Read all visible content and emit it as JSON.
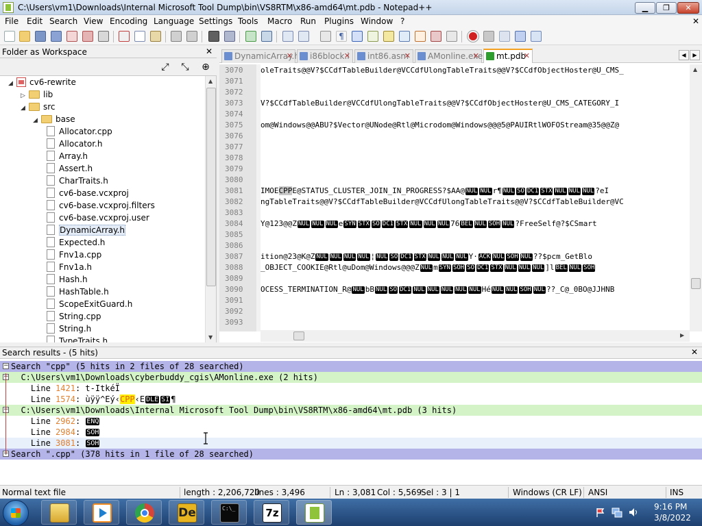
{
  "window": {
    "title": "C:\\Users\\vm1\\Downloads\\Internal Microsoft Tool Dump\\bin\\VS8RTM\\x86-amd64\\mt.pdb - Notepad++",
    "minimize": "▁",
    "maximize": "❐",
    "close": "✕"
  },
  "menu": {
    "items": [
      "File",
      "Edit",
      "Search",
      "View",
      "Encoding",
      "Language",
      "Settings",
      "Tools",
      "Macro",
      "Run",
      "Plugins",
      "Window",
      "?"
    ],
    "close": "✕"
  },
  "left_panel": {
    "title": "Folder as Workspace",
    "close": "✕",
    "tree": [
      {
        "label": "cv6-rewrite",
        "depth": 0,
        "kind": "project",
        "twisty": "◢"
      },
      {
        "label": "lib",
        "depth": 1,
        "kind": "folder",
        "twisty": "▷"
      },
      {
        "label": "src",
        "depth": 1,
        "kind": "folder",
        "twisty": "◢"
      },
      {
        "label": "base",
        "depth": 2,
        "kind": "folder",
        "twisty": "◢"
      },
      {
        "label": "Allocator.cpp",
        "depth": 3,
        "kind": "file"
      },
      {
        "label": "Allocator.h",
        "depth": 3,
        "kind": "file"
      },
      {
        "label": "Array.h",
        "depth": 3,
        "kind": "file"
      },
      {
        "label": "Assert.h",
        "depth": 3,
        "kind": "file"
      },
      {
        "label": "CharTraits.h",
        "depth": 3,
        "kind": "file"
      },
      {
        "label": "cv6-base.vcxproj",
        "depth": 3,
        "kind": "file"
      },
      {
        "label": "cv6-base.vcxproj.filters",
        "depth": 3,
        "kind": "file"
      },
      {
        "label": "cv6-base.vcxproj.user",
        "depth": 3,
        "kind": "file"
      },
      {
        "label": "DynamicArray.h",
        "depth": 3,
        "kind": "file",
        "selected": true
      },
      {
        "label": "Expected.h",
        "depth": 3,
        "kind": "file"
      },
      {
        "label": "Fnv1a.cpp",
        "depth": 3,
        "kind": "file"
      },
      {
        "label": "Fnv1a.h",
        "depth": 3,
        "kind": "file"
      },
      {
        "label": "Hash.h",
        "depth": 3,
        "kind": "file"
      },
      {
        "label": "HashTable.h",
        "depth": 3,
        "kind": "file"
      },
      {
        "label": "ScopeExitGuard.h",
        "depth": 3,
        "kind": "file"
      },
      {
        "label": "String.cpp",
        "depth": 3,
        "kind": "file"
      },
      {
        "label": "String.h",
        "depth": 3,
        "kind": "file"
      },
      {
        "label": "TypeTraits.h",
        "depth": 3,
        "kind": "file"
      }
    ]
  },
  "tabs": [
    {
      "label": "DynamicArray.h",
      "active": false
    },
    {
      "label": "i86block.i",
      "active": false
    },
    {
      "label": "int86.asm",
      "active": false
    },
    {
      "label": "AMonline.exe",
      "active": false
    },
    {
      "label": "mt.pdb",
      "active": true
    }
  ],
  "tab_close": "✕",
  "editor": {
    "lines": [
      {
        "n": "3070",
        "segs": [
          {
            "t": "oleTraits@@V?$CCdfTableBuilder@VCCdfUlongTableTraits@@V?$CCdfObjectHoster@U_CMS_"
          }
        ]
      },
      {
        "n": "3071",
        "segs": []
      },
      {
        "n": "3072",
        "segs": []
      },
      {
        "n": "3073",
        "segs": [
          {
            "t": "V?$CCdfTableBuilder@VCCdfUlongTableTraits@@V?$CCdfObjectHoster@U_CMS_CATEGORY_I"
          }
        ]
      },
      {
        "n": "3074",
        "segs": []
      },
      {
        "n": "3075",
        "segs": [
          {
            "t": "om@Windows@@ABU?$Vector@UNode@Rtl@Microdom@Windows@@@5@PAUIRtlWOFOStream@35@@Z@"
          }
        ]
      },
      {
        "n": "3076",
        "segs": []
      },
      {
        "n": "3077",
        "segs": []
      },
      {
        "n": "3078",
        "segs": []
      },
      {
        "n": "3079",
        "segs": []
      },
      {
        "n": "3080",
        "segs": []
      },
      {
        "n": "3081",
        "segs": [
          {
            "t": "IMOE"
          },
          {
            "t": "CPP",
            "h": true
          },
          {
            "t": "E@STATUS_CLUSTER_JOIN_IN_PROGRESS?$AA@"
          },
          {
            "c": "NUL"
          },
          {
            "c": "NUL"
          },
          {
            "t": "r¶"
          },
          {
            "c": "NUL"
          },
          {
            "c": "SO"
          },
          {
            "c": "DC1"
          },
          {
            "c": "STX"
          },
          {
            "c": "NUL"
          },
          {
            "c": "NUL"
          },
          {
            "c": "NUL"
          },
          {
            "t": "?eI"
          }
        ]
      },
      {
        "n": "3082",
        "segs": [
          {
            "t": "ngTableTraits@@V?$CCdfTableBuilder@VCCdfUlongTableTraits@@V?$CCdfTableBuilder@VC"
          }
        ]
      },
      {
        "n": "3083",
        "segs": []
      },
      {
        "n": "3084",
        "segs": [
          {
            "t": "Y@123@@Z"
          },
          {
            "c": "NUL"
          },
          {
            "c": "NUL"
          },
          {
            "c": "NUL"
          },
          {
            "t": "e"
          },
          {
            "c": "SYN"
          },
          {
            "c": "STX"
          },
          {
            "c": "SO"
          },
          {
            "c": "DC1"
          },
          {
            "c": "STX"
          },
          {
            "c": "NUL"
          },
          {
            "c": "NUL"
          },
          {
            "c": "NUL"
          },
          {
            "t": "76"
          },
          {
            "c": "BEL"
          },
          {
            "c": "NUL"
          },
          {
            "c": "SOH"
          },
          {
            "c": "NUL"
          },
          {
            "t": "?FreeSelf@?$CSmart"
          }
        ]
      },
      {
        "n": "3085",
        "segs": []
      },
      {
        "n": "3086",
        "segs": []
      },
      {
        "n": "3087",
        "segs": [
          {
            "t": "ition@23@K@Z"
          },
          {
            "c": "NUL"
          },
          {
            "c": "NUL"
          },
          {
            "c": "NUL"
          },
          {
            "c": "NUL"
          },
          {
            "t": "¦"
          },
          {
            "c": "NUL"
          },
          {
            "c": "SO"
          },
          {
            "c": "DC1"
          },
          {
            "c": "STX"
          },
          {
            "c": "NUL"
          },
          {
            "c": "NUL"
          },
          {
            "c": "NUL"
          },
          {
            "t": "Y·"
          },
          {
            "c": "ACK"
          },
          {
            "c": "NUL"
          },
          {
            "c": "SOH"
          },
          {
            "c": "NUL"
          },
          {
            "t": "??$pcm_GetBlo"
          }
        ]
      },
      {
        "n": "3088",
        "segs": [
          {
            "t": "_OBJECT_COOKIE@Rtl@uDom@Windows@@@Z"
          },
          {
            "c": "NUL"
          },
          {
            "t": "m"
          },
          {
            "c": "SYN"
          },
          {
            "c": "SOH"
          },
          {
            "c": "SO"
          },
          {
            "c": "DC1"
          },
          {
            "c": "STX"
          },
          {
            "c": "NUL"
          },
          {
            "c": "NUL"
          },
          {
            "c": "NUL"
          },
          {
            "t": "]l"
          },
          {
            "c": "BEL"
          },
          {
            "c": "NUL"
          },
          {
            "c": "SOH"
          }
        ]
      },
      {
        "n": "3089",
        "segs": []
      },
      {
        "n": "3090",
        "segs": [
          {
            "t": "OCESS_TERMINATION_R@"
          },
          {
            "c": "NUL"
          },
          {
            "t": "bB"
          },
          {
            "c": "NUL"
          },
          {
            "c": "SO"
          },
          {
            "c": "DC1"
          },
          {
            "c": "NUL"
          },
          {
            "c": "NUL"
          },
          {
            "c": "NUL"
          },
          {
            "c": "NUL"
          },
          {
            "c": "NUL"
          },
          {
            "t": "Hé"
          },
          {
            "c": "NUL"
          },
          {
            "c": "NUL"
          },
          {
            "c": "SOH"
          },
          {
            "c": "NUL"
          },
          {
            "t": "??_C@_0BO@JJHNB"
          }
        ]
      },
      {
        "n": "3091",
        "segs": []
      },
      {
        "n": "3092",
        "segs": []
      },
      {
        "n": "3093",
        "segs": []
      }
    ]
  },
  "search": {
    "title": "Search results - (5 hits)",
    "close": "✕",
    "rows": [
      {
        "kind": "search-head",
        "fold": "−",
        "text": "Search \"cpp\" (5 hits in 2 files of 28 searched)"
      },
      {
        "kind": "file-head",
        "fold": "−",
        "text": "  C:\\Users\\vm1\\Downloads\\cyberbuddy_cgis\\AMonline.exe (2 hits)"
      },
      {
        "kind": "hit",
        "prefix": "    Line ",
        "num": "1421",
        "sep": ": ",
        "text": "t-ItkéÏ"
      },
      {
        "kind": "hit",
        "prefix": "    Line ",
        "num": "1574",
        "sep": ": ",
        "text": "ùÿÿ^Eý‹",
        "hit": "CPP",
        "codes": [
          "DLE",
          "SI"
        ],
        "tail": "¶",
        "pre": "‹E"
      },
      {
        "kind": "file-head",
        "fold": "−",
        "text": "  C:\\Users\\vm1\\Downloads\\Internal Microsoft Tool Dump\\bin\\VS8RTM\\x86-amd64\\mt.pdb (3 hits)"
      },
      {
        "kind": "hit",
        "prefix": "    Line ",
        "num": "2962",
        "sep": ": ",
        "codes": [
          "ENQ"
        ]
      },
      {
        "kind": "hit",
        "prefix": "    Line ",
        "num": "2984",
        "sep": ": ",
        "codes": [
          "SOH"
        ]
      },
      {
        "kind": "hit",
        "prefix": "    Line ",
        "num": "3081",
        "sep": ": ",
        "codes": [
          "SOH"
        ],
        "current": true
      },
      {
        "kind": "search-head",
        "fold": "+",
        "text": "Search \".cpp\" (378 hits in 1 file of 28 searched)"
      }
    ]
  },
  "status": {
    "type": "Normal text file",
    "length": "length : 2,206,720",
    "lines": "lines : 3,496",
    "ln": "Ln : 3,081",
    "col": "Col : 5,569",
    "sel": "Sel : 3 | 1",
    "eol": "Windows (CR LF)",
    "encoding": "ANSI",
    "mode": "INS"
  },
  "taskbar": {
    "time": "9:16 PM",
    "date": "3/8/2022",
    "apps": [
      {
        "name": "file-explorer",
        "color": "#e8c14a"
      },
      {
        "name": "media-player",
        "color": "#f28a1e"
      },
      {
        "name": "chrome",
        "color": "#d6453a"
      },
      {
        "name": "de-app",
        "color": "#d9a21a"
      },
      {
        "name": "command-prompt",
        "color": "#101010"
      },
      {
        "name": "7zip",
        "color": "#ffffff"
      },
      {
        "name": "notepad-plus-plus",
        "color": "#8fc33c"
      }
    ],
    "cmd_label": "C:\\_",
    "zip_label": "7z",
    "de_label": "De"
  }
}
